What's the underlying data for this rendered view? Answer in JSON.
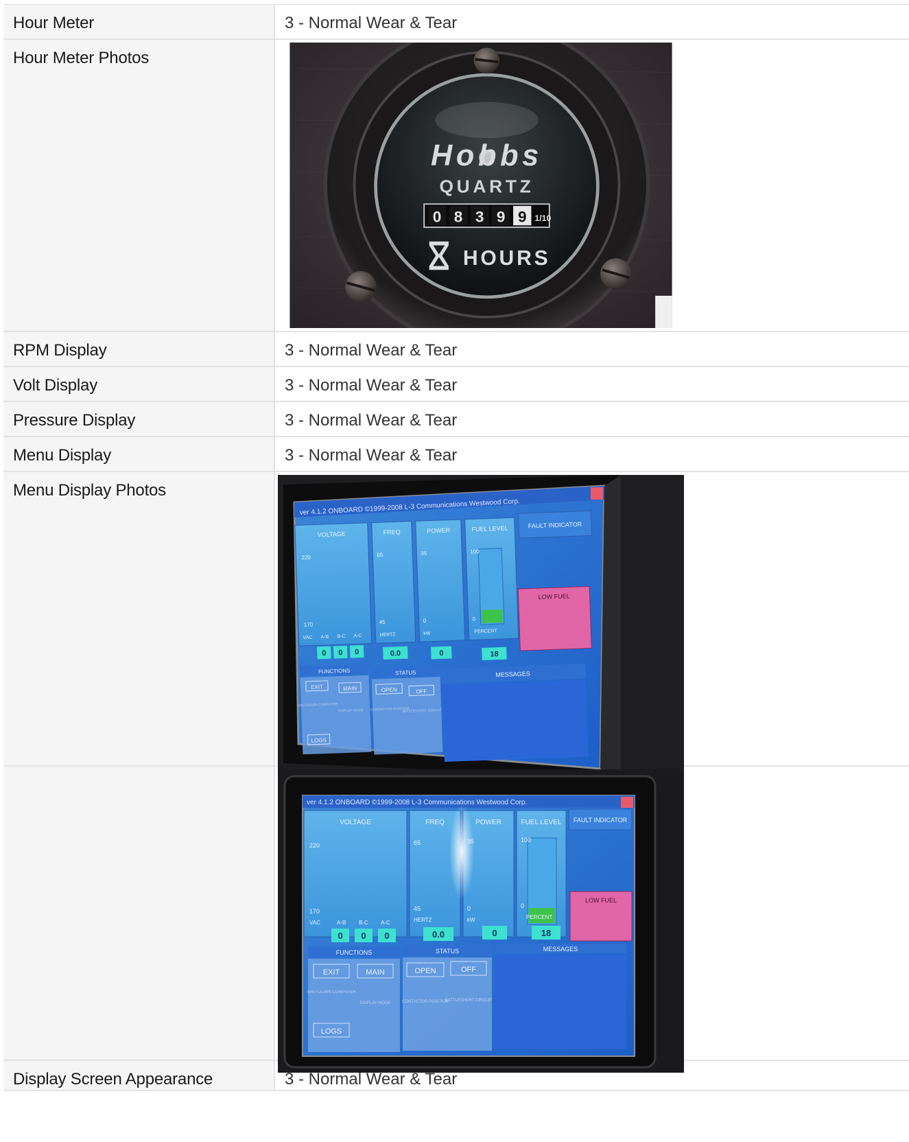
{
  "rows": [
    {
      "label": "Hour Meter",
      "value": "3 - Normal Wear & Tear"
    },
    {
      "label": "Hour Meter Photos"
    },
    {
      "label": "RPM Display",
      "value": "3 - Normal Wear & Tear"
    },
    {
      "label": "Volt Display",
      "value": "3 - Normal Wear & Tear"
    },
    {
      "label": "Pressure Display",
      "value": "3 - Normal Wear & Tear"
    },
    {
      "label": "Menu Display",
      "value": "3 - Normal Wear & Tear"
    },
    {
      "label": "Menu Display Photos"
    },
    {
      "label": ""
    },
    {
      "label": "Display Screen Appearance",
      "value": "3 - Normal Wear & Tear"
    }
  ],
  "hour_meter_photo": {
    "brand": "Hobbs",
    "model": "QUARTZ",
    "digits": [
      "0",
      "8",
      "3",
      "9",
      "9"
    ],
    "tenths_label": "1/10",
    "unit": "HOURS"
  },
  "menu_screen": {
    "header": "ver 4.1.2  ONBOARD   ©1999-2008  L-3 Communications Westwood Corp.",
    "panels": {
      "voltage": "VOLTAGE",
      "freq": "FREQ",
      "power": "POWER",
      "fuel": "FUEL LEVEL",
      "fault": "FAULT INDICATOR"
    },
    "fault_message": "LOW FUEL",
    "scale": {
      "volt_top": "220",
      "volt_bottom": "170",
      "freq_top": "65",
      "freq_bottom": "45",
      "power_top": "35",
      "power_bottom": "0",
      "fuel_top": "100",
      "fuel_bottom": "0"
    },
    "units": {
      "volt": "VAC",
      "freq": "HERTZ",
      "power": "kW",
      "fuel": "PERCENT"
    },
    "phases": [
      "A-B",
      "B-C",
      "A-C"
    ],
    "readouts": {
      "volt_ab": "0",
      "volt_bc": "0",
      "volt_ac": "0",
      "freq": "0.0",
      "power": "0",
      "fuel": "18"
    },
    "fuel_level_percent": 18,
    "sections": {
      "functions": "FUNCTIONS",
      "status": "STATUS",
      "messages": "MESSAGES"
    },
    "buttons": {
      "exit": "EXIT",
      "main": "MAIN",
      "open": "OPEN",
      "off": "OFF",
      "logs": "LOGS"
    },
    "captions": {
      "shutdown": "SHUTDOWN COMPUTER",
      "display": "DISPLAY MODE",
      "contactor": "CONTACTOR POSITION",
      "battleshort": "BATTLESHORT CIRCUIT"
    }
  }
}
